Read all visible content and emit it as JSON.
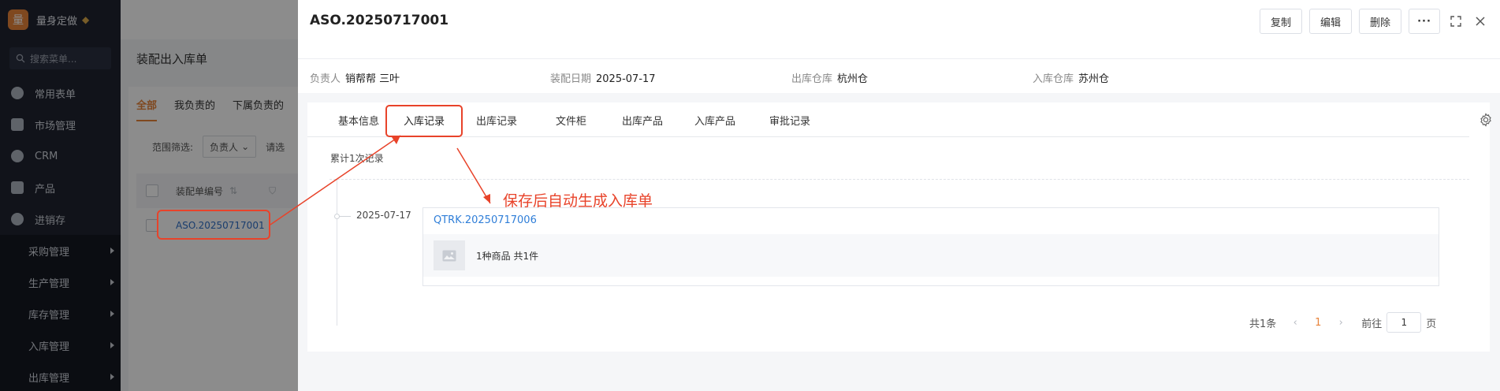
{
  "sidebar": {
    "brand_logo_char": "量",
    "brand_name": "量身定做",
    "search_placeholder": "搜索菜单...",
    "items": [
      {
        "label": "常用表单",
        "icon": "star-icon"
      },
      {
        "label": "市场管理",
        "icon": "clipboard-icon"
      },
      {
        "label": "CRM",
        "icon": "pie-chart-icon"
      },
      {
        "label": "产品",
        "icon": "grid-icon"
      },
      {
        "label": "进销存",
        "icon": "cycle-icon"
      }
    ],
    "sub_items": [
      {
        "label": "采购管理"
      },
      {
        "label": "生产管理"
      },
      {
        "label": "库存管理"
      },
      {
        "label": "入库管理"
      },
      {
        "label": "出库管理"
      }
    ]
  },
  "list_page": {
    "title": "装配出入库单",
    "tabs": [
      "全部",
      "我负责的",
      "下属负责的"
    ],
    "filter_label": "范围筛选:",
    "filter_select": "负责人",
    "filter_placeholder": "请选",
    "column_header": "装配单编号",
    "row_value": "ASO.20250717001"
  },
  "drawer": {
    "title": "ASO.20250717001",
    "buttons": {
      "copy": "复制",
      "edit": "编辑",
      "delete": "删除",
      "more": "···"
    },
    "info": [
      {
        "label": "负责人",
        "value": "销帮帮 三叶"
      },
      {
        "label": "装配日期",
        "value": "2025-07-17"
      },
      {
        "label": "出库仓库",
        "value": "杭州仓"
      },
      {
        "label": "入库仓库",
        "value": "苏州仓"
      }
    ],
    "tabs": [
      "基本信息",
      "入库记录",
      "出库记录",
      "文件柜",
      "出库产品",
      "入库产品",
      "审批记录"
    ],
    "active_tab": "入库记录",
    "record_count": "累计1次记录",
    "timeline_date": "2025-07-17",
    "record": {
      "code": "QTRK.20250717006",
      "description": "1种商品 共1件"
    },
    "pagination": {
      "total": "共1条",
      "current_page": "1",
      "goto_label": "前往",
      "goto_value": "1",
      "unit": "页"
    }
  },
  "annotation": {
    "text": "保存后自动生成入库单",
    "color": "#e8432a"
  },
  "colors": {
    "accent": "#e8833a",
    "link": "#2f7ed8",
    "annotation": "#e8432a"
  }
}
